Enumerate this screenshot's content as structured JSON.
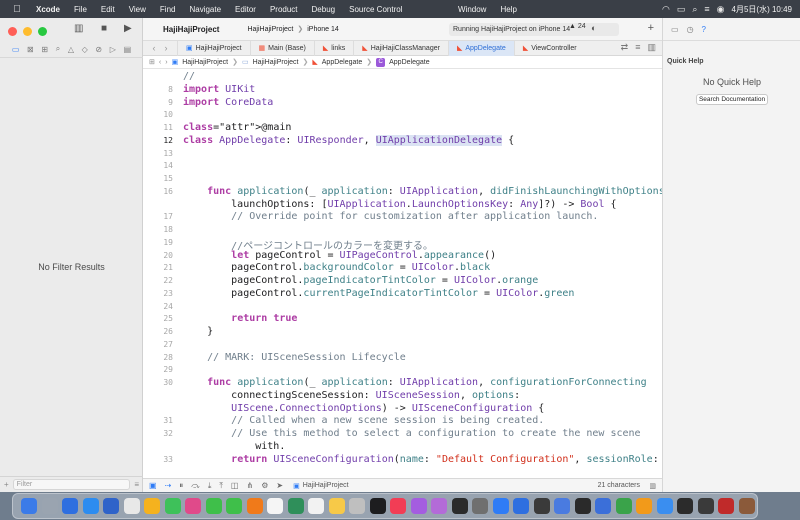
{
  "menubar": {
    "apple_glyph": "",
    "app_name": "Xcode",
    "items": [
      "File",
      "Edit",
      "View",
      "Find",
      "Navigate",
      "Editor",
      "Product",
      "Debug",
      "Source Control",
      "Window",
      "Help"
    ],
    "clock": "4月5日(水) 10:49"
  },
  "navigator": {
    "empty_text": "No Filter Results",
    "filter_placeholder": "Filter"
  },
  "toolbar": {
    "project_name": "HajiHajiProject",
    "scheme_project": "HajiHajiProject",
    "scheme_device": "iPhone 14",
    "status": "Running HajiHajiProject on iPhone 14",
    "warning_count": "24"
  },
  "tabs": [
    {
      "label": "HajiHajiProject",
      "active": false
    },
    {
      "label": "Main (Base)",
      "active": false
    },
    {
      "label": "links",
      "active": false
    },
    {
      "label": "HajiHajiClassManager",
      "active": false
    },
    {
      "label": "AppDelegate",
      "active": true
    },
    {
      "label": "ViewController",
      "active": false
    }
  ],
  "jumpbar": [
    "HajiHajiProject",
    "HajiHajiProject",
    "AppDelegate",
    "AppDelegate"
  ],
  "editor": {
    "current_line": "12",
    "lines": [
      {
        "num": "",
        "text": "//"
      },
      {
        "num": "8",
        "text": "import UIKit"
      },
      {
        "num": "9",
        "text": "import CoreData"
      },
      {
        "num": "10",
        "text": ""
      },
      {
        "num": "11",
        "text": "@main"
      },
      {
        "num": "12",
        "text": "class AppDelegate: UIResponder, UIApplicationDelegate {"
      },
      {
        "num": "13",
        "text": ""
      },
      {
        "num": "14",
        "text": ""
      },
      {
        "num": "15",
        "text": ""
      },
      {
        "num": "16",
        "text": "    func application(_ application: UIApplication, didFinishLaunchingWithOptions"
      },
      {
        "num": "",
        "text": "        launchOptions: [UIApplication.LaunchOptionsKey: Any]?) -> Bool {"
      },
      {
        "num": "17",
        "text": "        // Override point for customization after application launch."
      },
      {
        "num": "18",
        "text": ""
      },
      {
        "num": "19",
        "text": "        //ページコントロールのカラーを変更する。"
      },
      {
        "num": "20",
        "text": "        let pageControl = UIPageControl.appearance()"
      },
      {
        "num": "21",
        "text": "        pageControl.backgroundColor = UIColor.black"
      },
      {
        "num": "22",
        "text": "        pageControl.pageIndicatorTintColor = UIColor.orange"
      },
      {
        "num": "23",
        "text": "        pageControl.currentPageIndicatorTintColor = UIColor.green"
      },
      {
        "num": "24",
        "text": ""
      },
      {
        "num": "25",
        "text": "        return true"
      },
      {
        "num": "26",
        "text": "    }"
      },
      {
        "num": "27",
        "text": ""
      },
      {
        "num": "28",
        "text": "    // MARK: UISceneSession Lifecycle"
      },
      {
        "num": "29",
        "text": ""
      },
      {
        "num": "30",
        "text": "    func application(_ application: UIApplication, configurationForConnecting"
      },
      {
        "num": "",
        "text": "        connectingSceneSession: UISceneSession, options:"
      },
      {
        "num": "",
        "text": "        UIScene.ConnectionOptions) -> UISceneConfiguration {"
      },
      {
        "num": "31",
        "text": "        // Called when a new scene session is being created."
      },
      {
        "num": "32",
        "text": "        // Use this method to select a configuration to create the new scene"
      },
      {
        "num": "",
        "text": "            with."
      },
      {
        "num": "33",
        "text": "        return UISceneConfiguration(name: \"Default Configuration\", sessionRole:"
      }
    ]
  },
  "debugbar": {
    "target": "HajiHajiProject",
    "char_count": "21 characters"
  },
  "inspector": {
    "title": "Quick Help",
    "empty_text": "No Quick Help",
    "button_label": "Search Documentation"
  },
  "dock": {
    "icon_colors": [
      "#3b7be8",
      "#9aa4b0",
      "#2f6fe0",
      "#2d8cf0",
      "#2f63c9",
      "#e8e8e8",
      "#f5b21e",
      "#3ec15a",
      "#e04a8a",
      "#3fbf4a",
      "#3fbf4a",
      "#f07a1a",
      "#f5f5f5",
      "#2f8f5a",
      "#f2f2f2",
      "#f7c948",
      "#bfbfbf",
      "#1d1d1f",
      "#f23d55",
      "#a45de0",
      "#b36bd8",
      "#2b2b2b",
      "#6f6f6f",
      "#2f7cf6",
      "#2e6fe0",
      "#3a3a3a",
      "#4a7be0",
      "#2a2a2a",
      "#3b6fd9",
      "#3aa34a",
      "#f29a1a",
      "#3a8ef0",
      "#2b2b2b",
      "#3a3a3a",
      "#c02a2a",
      "#8b5a3a"
    ]
  }
}
